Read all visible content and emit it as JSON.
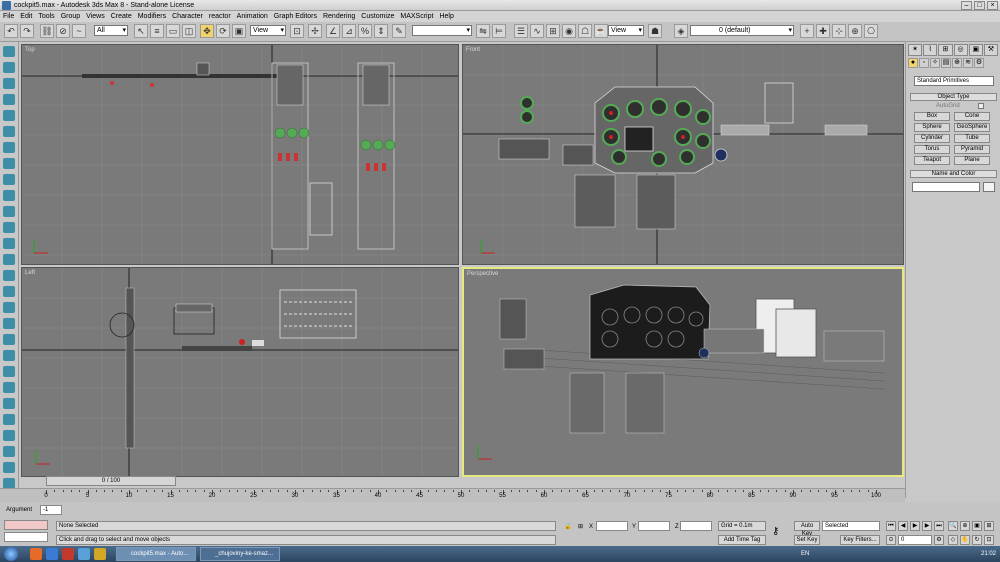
{
  "title": "cockpit5.max - Autodesk 3ds Max 8 - Stand-alone License",
  "menu": [
    "File",
    "Edit",
    "Tools",
    "Group",
    "Views",
    "Create",
    "Modifiers",
    "Character",
    "reactor",
    "Animation",
    "Graph Editors",
    "Rendering",
    "Customize",
    "MAXScript",
    "Help"
  ],
  "toolbar": {
    "filter": "All",
    "ref_coord": "View",
    "named_sel": "",
    "pivot": "View",
    "layer": "0 (default)"
  },
  "viewports": {
    "top": "Top",
    "front": "Front",
    "left": "Left",
    "perspective": "Perspective"
  },
  "command_panel": {
    "tabs": [
      "",
      "",
      "",
      "",
      "",
      ""
    ],
    "category": "Standard Primitives",
    "object_type_header": "Object Type",
    "autogrid": "AutoGrid",
    "buttons": [
      "Box",
      "Cone",
      "Sphere",
      "GeoSphere",
      "Cylinder",
      "Tube",
      "Torus",
      "Pyramid",
      "Teapot",
      "Plane"
    ],
    "name_color_header": "Name and Color"
  },
  "timeline": {
    "slider": "0 / 100",
    "ticks": [
      "0",
      "5",
      "10",
      "15",
      "20",
      "25",
      "30",
      "35",
      "40",
      "45",
      "50",
      "55",
      "60",
      "65",
      "70",
      "75",
      "80",
      "85",
      "90",
      "95",
      "100"
    ]
  },
  "status": {
    "argument_label": "Argument",
    "argument_value": "-1",
    "selection": "None Selected",
    "prompt": "Click and drag to select and move objects",
    "x_label": "X",
    "y_label": "Y",
    "z_label": "Z",
    "grid": "Grid = 0.1m",
    "add_time_tag": "Add Time Tag",
    "auto_key": "Auto Key",
    "set_key": "Set Key",
    "key_filters": "Key Filters...",
    "selected": "Selected",
    "frame": "0"
  },
  "taskbar": {
    "task1": "cockpit5.max - Auto...",
    "task2": "_chujoviny-ke-smaz...",
    "lang": "EN",
    "clock": "21:02"
  }
}
